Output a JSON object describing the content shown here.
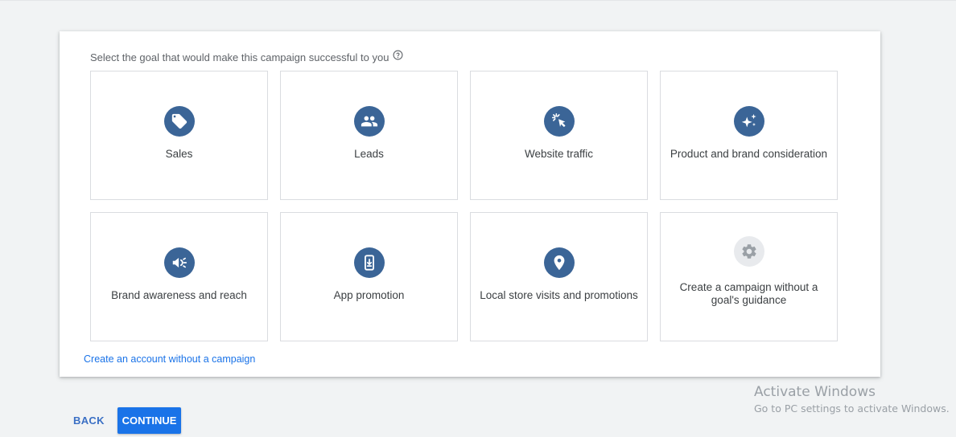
{
  "prompt": {
    "text": "Select the goal that would make this campaign successful to you",
    "help_icon": "help-circle-icon"
  },
  "goals": [
    {
      "label": "Sales",
      "icon": "tag-icon"
    },
    {
      "label": "Leads",
      "icon": "people-icon"
    },
    {
      "label": "Website traffic",
      "icon": "cursor-click-icon"
    },
    {
      "label": "Product and brand consideration",
      "icon": "sparkle-icon"
    },
    {
      "label": "Brand awareness and reach",
      "icon": "megaphone-icon"
    },
    {
      "label": "App promotion",
      "icon": "phone-download-icon"
    },
    {
      "label": "Local store visits and promotions",
      "icon": "map-pin-icon"
    },
    {
      "label": "Create a campaign without a goal's guidance",
      "icon": "gear-icon"
    }
  ],
  "account_link": "Create an account without a campaign",
  "buttons": {
    "back": "BACK",
    "continue": "CONTINUE"
  },
  "watermark": {
    "title": "Activate Windows",
    "subtitle": "Go to PC settings to activate Windows."
  },
  "colors": {
    "accent": "#1a73e8",
    "icon_circle": "#3b6597",
    "icon_circle_disabled": "#e8eaed",
    "background": "#f1f3f4"
  }
}
